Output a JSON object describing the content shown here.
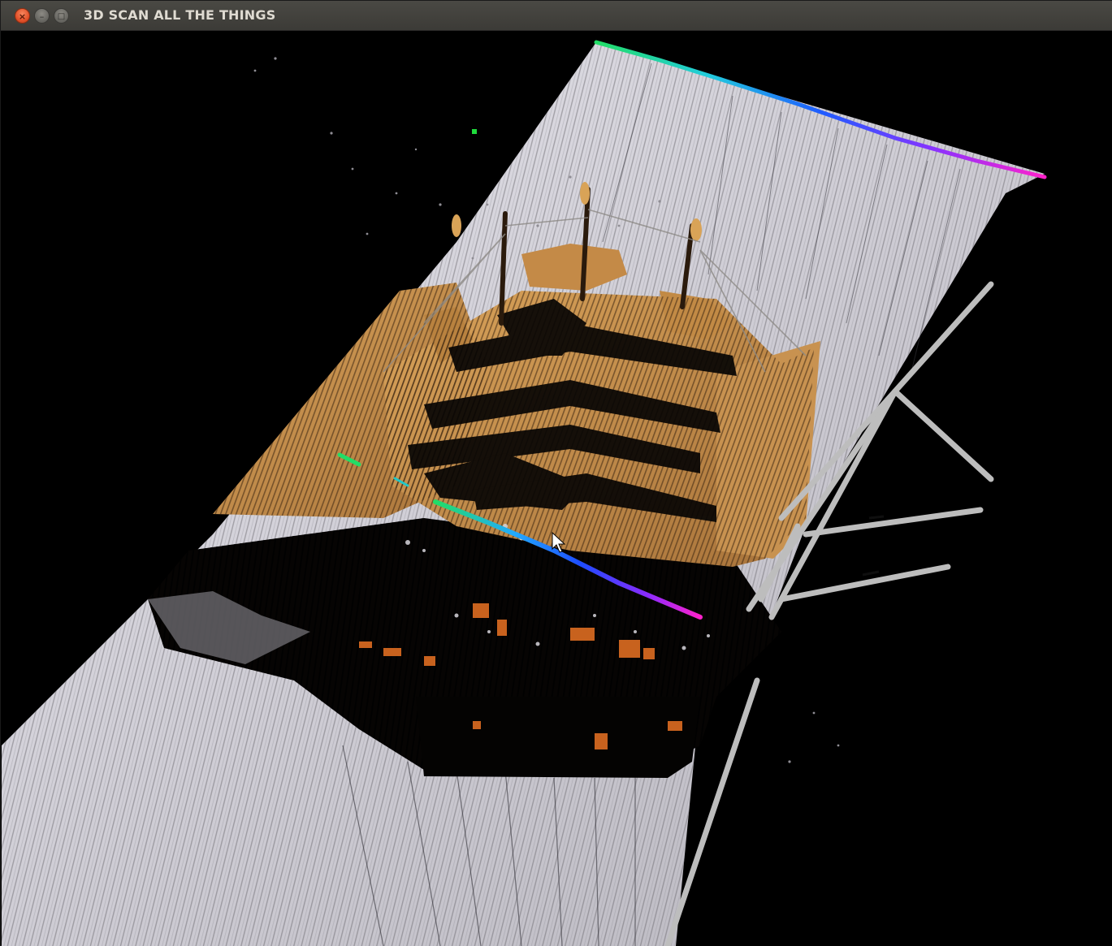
{
  "window": {
    "title": "3D SCAN ALL THE THINGS",
    "buttons": {
      "close_glyph": "×",
      "minimize_glyph": "–",
      "maximize_glyph": "□"
    }
  },
  "viewport": {
    "scene": "point-cloud",
    "colors": {
      "background": "#000000",
      "floor": "#c9c7cf",
      "ship_hull": "#c28a45",
      "ship_dark": "#0a0705",
      "accent_orange": "#d2691e",
      "axis_green": "#22dd66",
      "axis_blue": "#1e5cff",
      "axis_magenta": "#ff22cc",
      "gizmo": "#bdbdbd"
    }
  }
}
